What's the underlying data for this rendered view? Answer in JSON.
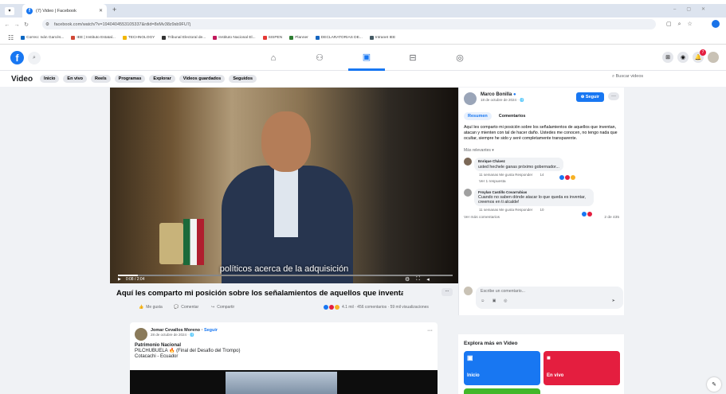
{
  "browser": {
    "tab_title": "(7) Video | Facebook",
    "url": "facebook.com/watch/?v=1940404553105337&rdid=8xMv38z9sb9FU7j",
    "bookmarks": [
      {
        "label": "Correo: Iván Garcés...",
        "color": "#0a66c2"
      },
      {
        "label": "IEE | Instituto Estatal...",
        "color": "#d14836"
      },
      {
        "label": "TECHNOLOGY",
        "color": "#f2b600"
      },
      {
        "label": "Tribunal Electoral de...",
        "color": "#333333"
      },
      {
        "label": "Instituto Nacional El...",
        "color": "#c2185b"
      },
      {
        "label": "SISPEN",
        "color": "#e53935"
      },
      {
        "label": "Planner",
        "color": "#2e7d32"
      },
      {
        "label": "DECLARATORIAS DE...",
        "color": "#1565c0"
      },
      {
        "label": "Intranet IEE",
        "color": "#455a64"
      }
    ]
  },
  "fb": {
    "logo": "f",
    "search_placeholder": "Buscar en Facebook",
    "nav_icons": [
      "home-icon",
      "friends-icon",
      "watch-icon",
      "marketplace-icon",
      "gaming-icon"
    ],
    "notif_count": "7"
  },
  "video_bar": {
    "title": "Video",
    "pills": [
      "Inicio",
      "En vivo",
      "Reels",
      "Programas",
      "Explorar",
      "Videos guardados",
      "Seguidos"
    ],
    "search_placeholder": "Buscar videos"
  },
  "player": {
    "subtitle": "políticos acerca de la adquisición",
    "time": "0:08 / 2:04"
  },
  "post": {
    "title": "Aquí les comparto mi posición sobre los señalamientos de aquellos que inventan, a...",
    "more": "...",
    "like": "Me gusta",
    "comment": "Comentar",
    "share": "Compartir",
    "stats": "4.1 mil · 456 comentarios · 59 mil visualizaciones"
  },
  "author": {
    "name": "Marco Bonilla",
    "date": "18 de octubre de 2024 · 🌐",
    "follow": "Seguir",
    "more": "···",
    "tabs": [
      "Resumen",
      "Comentarios"
    ],
    "description": "Aquí les comparto mi posición sobre los señalamientos de aquellos que inventan, atacan y mienten con tal de hacer daño. Ustedes me conocen, no tengo nada que ocultar, siempre he sido y seré completamente transparente."
  },
  "comments": {
    "sort": "Más relevantes ▾",
    "items": [
      {
        "name": "Enrique Chávez",
        "text": "usted hechele ganas próximo gobernador...",
        "meta": "11 semanas   Me gusta   Responder",
        "count": "14"
      },
      {
        "name": "Froylan Castillo Covarrubias",
        "text": "Cuando no saben dónde atacar lo que queda es inventar, creemos en ti alcalde!",
        "meta": "11 semanas   Me gusta   Responder",
        "count": "10"
      }
    ],
    "replies": "Ver 1 respuesta",
    "more": "Ver más comentarios",
    "count": "2 de 435",
    "write": "Escribe un comentario..."
  },
  "post2": {
    "author": "Jomar Cevallos Moreno",
    "follow": "Seguir",
    "date": "28 de octubre de 2024 · 🌐",
    "line1": "Patrimonio Nacional",
    "line2": "PILCHUBUELA 🔥 (Final del Desafio del Trompo)",
    "line3": "Cotacachi - Ecuador",
    "more": "···"
  },
  "explore": {
    "title": "Explora más en Video",
    "tiles": [
      {
        "label": "Inicio",
        "color": "#1877f2"
      },
      {
        "label": "En vivo",
        "color": "#e41e3f"
      }
    ]
  }
}
